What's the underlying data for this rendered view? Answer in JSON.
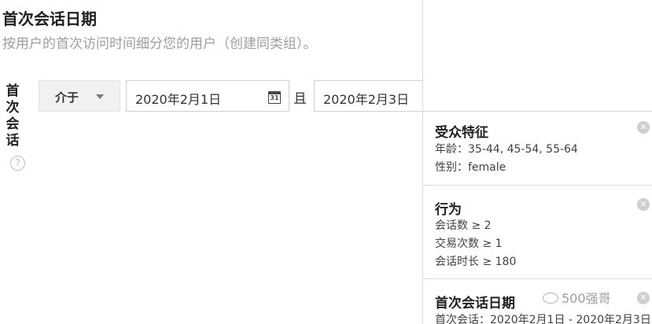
{
  "section": {
    "title": "首次会话日期",
    "subtitle": "按用户的首次访问时间细分您的用户（创建同类组）。"
  },
  "filter": {
    "label": "首次会话",
    "help_icon": "question-circle-icon",
    "operator": "介于",
    "start_date": "2020年2月1日",
    "calendar_icon_text": "31",
    "conjunction": "且",
    "end_date": "2020年2月3日"
  },
  "summary": {
    "cards": [
      {
        "title": "受众特征",
        "lines": [
          "年龄：35-44, 45-54, 55-64",
          "性别：female"
        ]
      },
      {
        "title": "行为",
        "lines": [
          "会话数 ≥ 2",
          "交易次数 ≥ 1",
          "会话时长 ≥ 180"
        ]
      },
      {
        "title": "首次会话日期",
        "lines": [
          "首次会话：2020年2月1日 - 2020年2月3日"
        ]
      }
    ],
    "remove_icon": "remove-circle-icon"
  },
  "watermark": {
    "text": "500强哥"
  },
  "colors": {
    "subtitle": "#9e9e9e",
    "select_bg": "#f1f1f1",
    "divider": "#dcdcdc",
    "remove_icon": "#cfcfcf"
  }
}
